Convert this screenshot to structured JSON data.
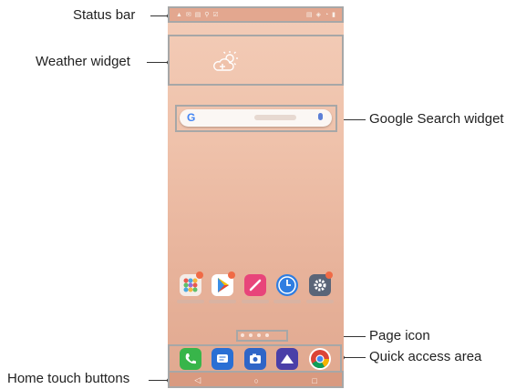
{
  "callouts": {
    "status_bar": "Status bar",
    "weather_widget": "Weather widget",
    "google_search_widget": "Google Search widget",
    "page_icon": "Page icon",
    "quick_access_area": "Quick access area",
    "home_touch_buttons": "Home touch buttons"
  },
  "search": {
    "logo": "G"
  },
  "status_icons": {
    "left": [
      "▲",
      "✉",
      "▤",
      "⚲",
      "☑"
    ],
    "right": [
      "▤",
      "◈",
      "◔",
      "▮"
    ]
  },
  "nav": {
    "back": "◁",
    "home": "○",
    "recents": "□"
  },
  "colors": {
    "phone_bg": "#efc2ab",
    "status_bar": "#e3a78f",
    "nav_bar": "#d99a80",
    "highlight_box": "#a7a7a7"
  }
}
